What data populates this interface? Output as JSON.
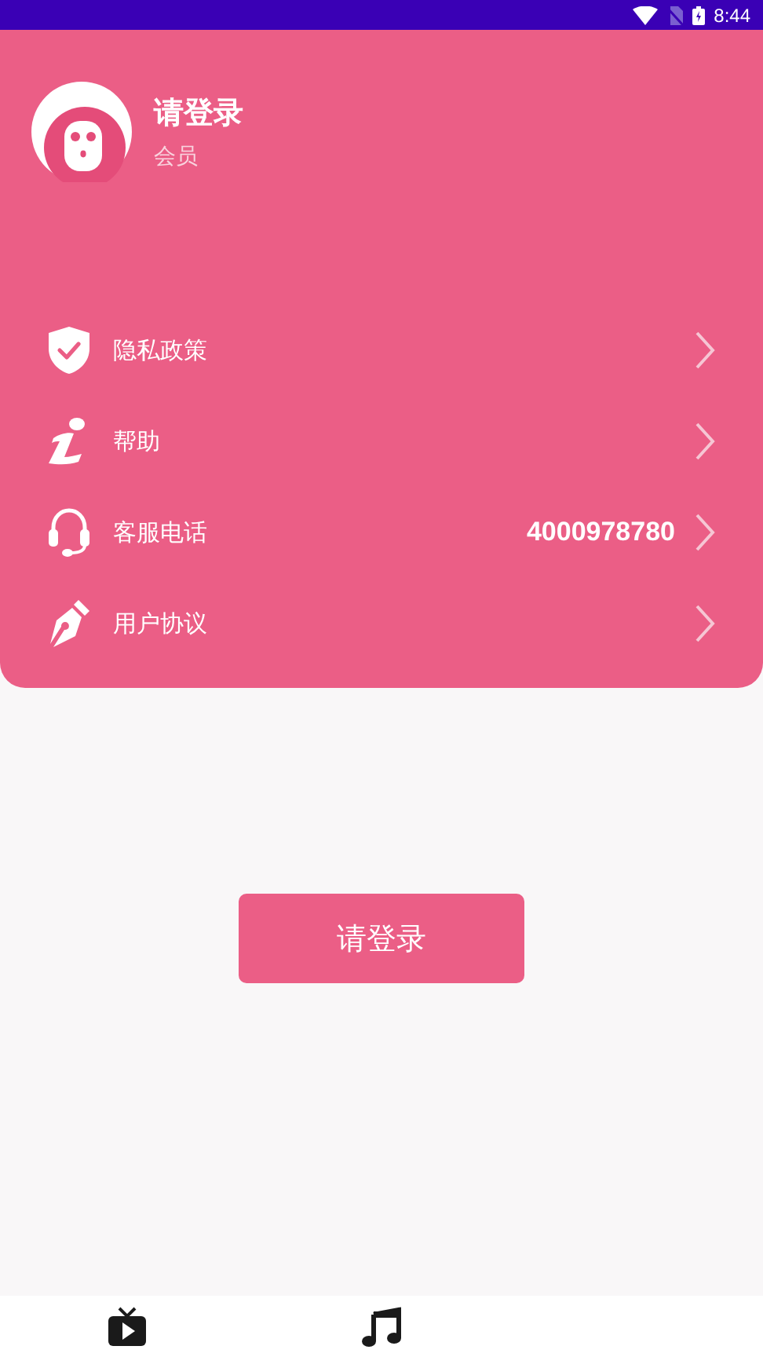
{
  "status_bar": {
    "time": "8:44"
  },
  "profile": {
    "name": "请登录",
    "subtitle": "会员"
  },
  "menu": [
    {
      "kind": "privacy",
      "label": "隐私政策"
    },
    {
      "kind": "help",
      "label": "帮助"
    },
    {
      "kind": "service",
      "label": "客服电话",
      "value": "4000978780"
    },
    {
      "kind": "agreement",
      "label": "用户协议"
    }
  ],
  "login_button": "请登录",
  "tab_bar": [
    {
      "kind": "video"
    },
    {
      "kind": "music"
    }
  ]
}
